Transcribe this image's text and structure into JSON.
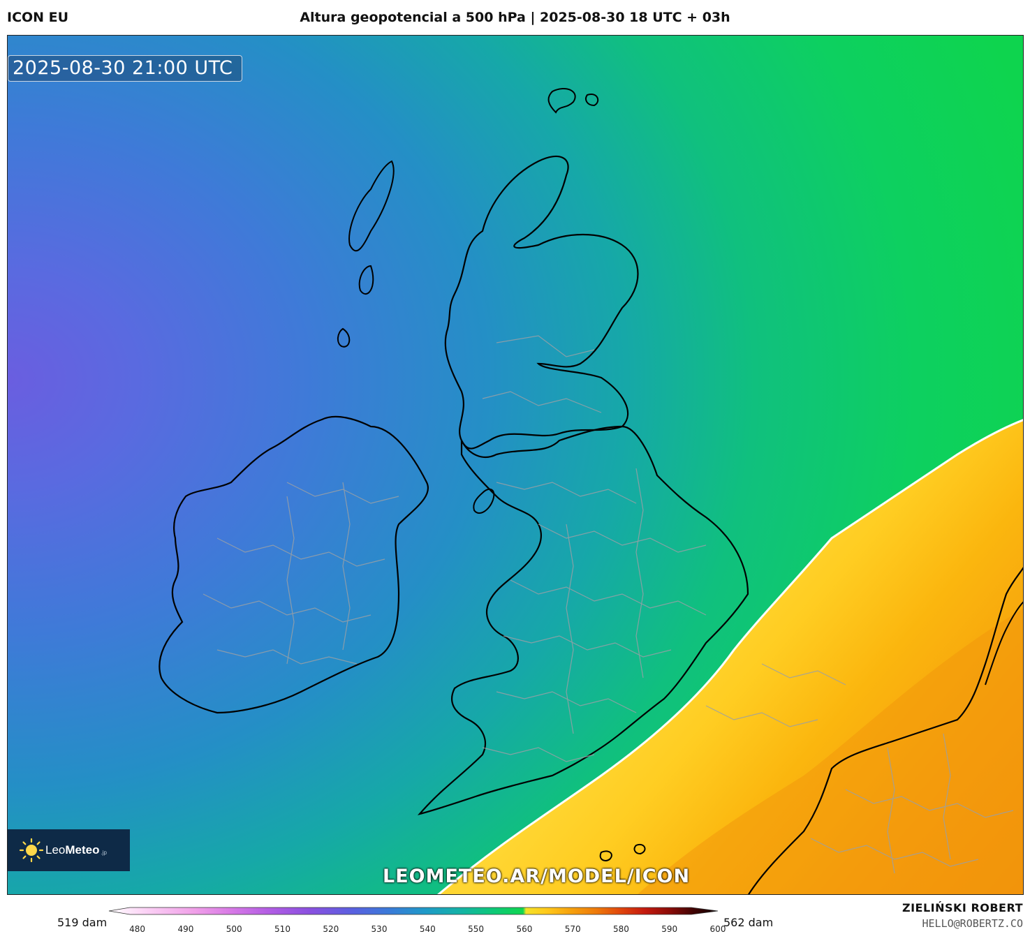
{
  "header": {
    "model": "ICON EU",
    "title": "Altura geopotencial a 500 hPa | 2025-08-30 18 UTC + 03h"
  },
  "map": {
    "valid_time": "2025-08-30 21:00 UTC",
    "watermark": "LEOMETEO.AR/MODEL/ICON",
    "logo": {
      "brand_light": "Leo",
      "brand_bold": "Meteo",
      "suffix": ".jp",
      "icon": "sun-icon"
    }
  },
  "colorbar": {
    "min_label": "519 dam",
    "max_label": "562 dam",
    "ticks": [
      "480",
      "490",
      "500",
      "510",
      "520",
      "530",
      "540",
      "550",
      "560",
      "570",
      "580",
      "590",
      "600"
    ],
    "tick_values": [
      480,
      490,
      500,
      510,
      520,
      530,
      540,
      550,
      560,
      570,
      580,
      590,
      600
    ],
    "range": [
      475,
      600
    ],
    "colors": {
      "low": "#ffffff",
      "pink": "#f3a6e8",
      "violet": "#9d4fe0",
      "blue": "#4f6fe0",
      "teal": "#1aa0c8",
      "green": "#0fd16a",
      "yellow": "#ffd932",
      "orange": "#f59a0a",
      "red": "#c81a0a",
      "dark": "#100000"
    }
  },
  "credits": {
    "author": "ZIELIŃSKI ROBERT",
    "email": "HELLO@ROBERTZ.CO"
  }
}
